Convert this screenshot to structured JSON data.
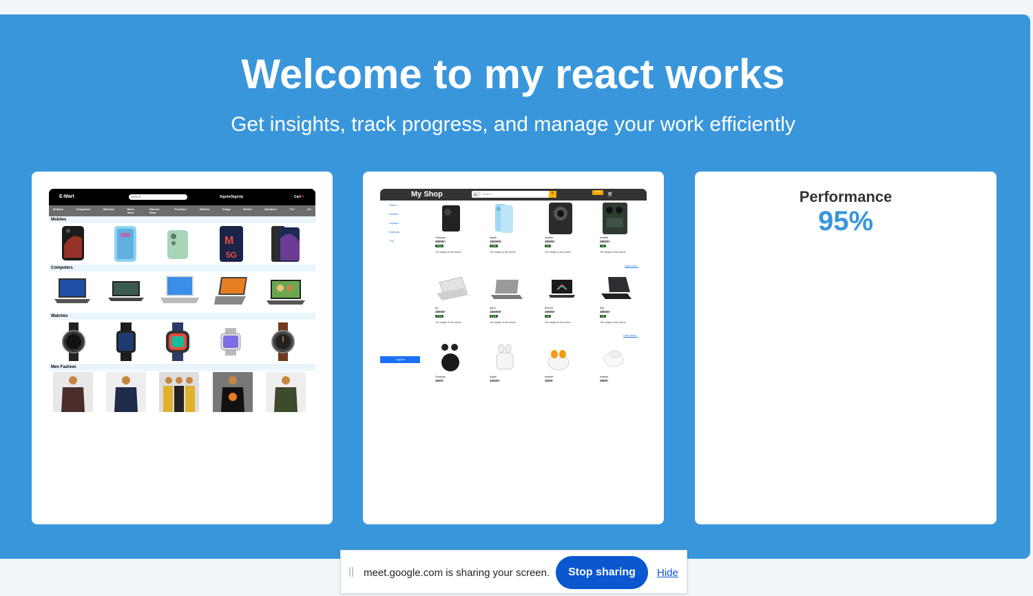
{
  "hero": {
    "title": "Welcome to my react works",
    "subtitle": "Get insights, track progress, and manage your work efficiently"
  },
  "emart": {
    "brand": "E-Mart",
    "search_placeholder": "Search...",
    "signin": "SignIn/SignUp",
    "cart": "Cart",
    "cart_count": "0",
    "categories": [
      "Mobiles",
      "Computers",
      "Watches",
      "Mens Wear",
      "Women Wear",
      "Furniture",
      "Kitchen",
      "Fridge",
      "Books",
      "Speakers",
      "TVs",
      "AC"
    ],
    "sections": [
      "Mobiles",
      "Computers",
      "Watches",
      "Men Fashion"
    ]
  },
  "myshop": {
    "brand": "My Shop",
    "search_all": "All",
    "search_placeholder": "Search",
    "login": "Login",
    "sidebar": [
      "Home",
      "Mobiles",
      "Laptops",
      "Earbuds",
      "TVs"
    ],
    "logout": "LogOut",
    "more_label_1": "click more...",
    "more_label_2": "Click More...",
    "mobiles": [
      {
        "name": "Oneplus",
        "price": "25000/-",
        "rating": "3.8★",
        "desc": "The weight of the phone"
      },
      {
        "name": "Apple",
        "price": "150000/-",
        "rating": "4.9★",
        "desc": "The weight of the phone"
      },
      {
        "name": "realme",
        "price": "30000/-",
        "rating": "4★",
        "desc": "The weight of the phone"
      },
      {
        "name": "realme",
        "price": "28000/-",
        "rating": "4★",
        "desc": "The weight of the phone"
      }
    ],
    "laptops": [
      {
        "name": "hp",
        "price": "25000/-",
        "rating": "3.5★",
        "desc": "The weight of the phone"
      },
      {
        "name": "asus",
        "price": "150000/-",
        "rating": "4.5★",
        "desc": "The weight of the phone"
      },
      {
        "name": "lenovo",
        "price": "30000/-",
        "rating": "4★",
        "desc": "The weight of the phone"
      },
      {
        "name": "dell",
        "price": "28000/-",
        "rating": "4★",
        "desc": "The weight of the phone"
      }
    ],
    "earbuds": [
      {
        "name": "Oneplus",
        "price": "2500/-"
      },
      {
        "name": "Apple",
        "price": "15000/-"
      },
      {
        "name": "realme",
        "price": "3000/-"
      },
      {
        "name": "realme",
        "price": "2800/-"
      }
    ]
  },
  "performance": {
    "title": "Performance",
    "value": "95%"
  },
  "share_bar": {
    "message": "meet.google.com is sharing your screen.",
    "stop_label": "Stop sharing",
    "hide_label": "Hide"
  },
  "colors": {
    "hero_bg": "#3996db",
    "accent": "#3996db",
    "stop_button": "#0b57d0"
  }
}
